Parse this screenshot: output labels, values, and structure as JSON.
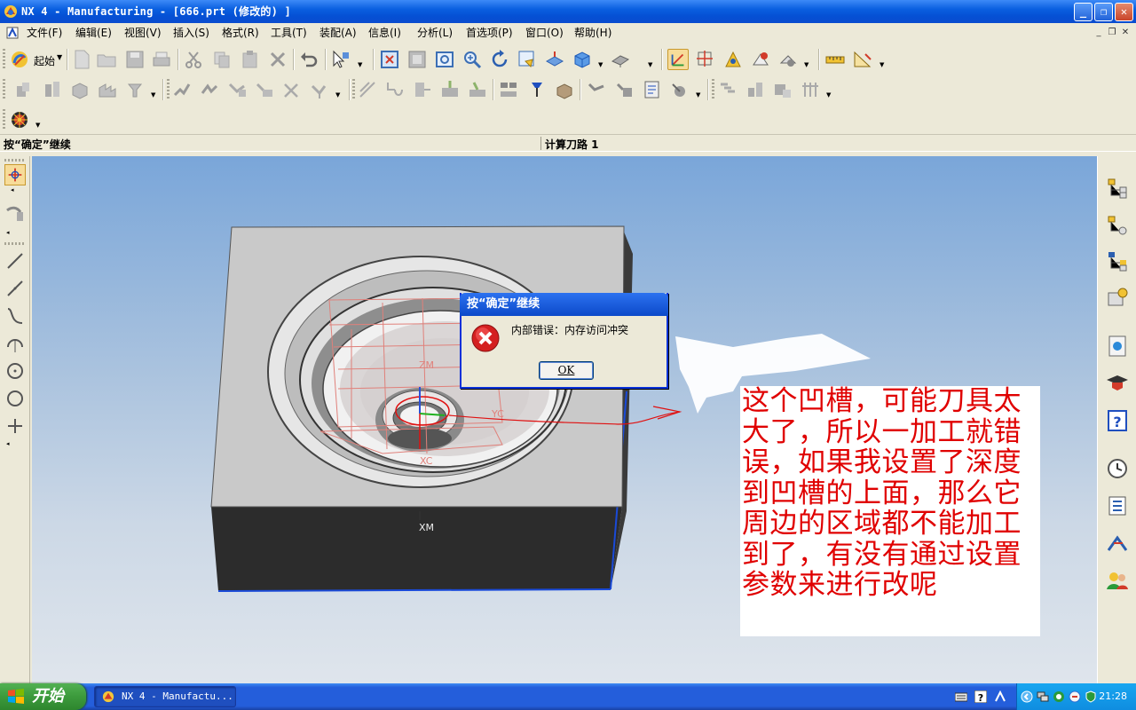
{
  "window": {
    "title": "NX 4 - Manufacturing - [666.prt (修改的) ]",
    "controls": [
      "minimize",
      "restore",
      "close"
    ]
  },
  "menubar": {
    "items": [
      "文件(F)",
      "编辑(E)",
      "视图(V)",
      "插入(S)",
      "格式(R)",
      "工具(T)",
      "装配(A)",
      "信息(I)",
      "分析(L)",
      "首选项(P)",
      "窗口(O)",
      "帮助(H)"
    ]
  },
  "toolbar": {
    "start_label": "起始"
  },
  "status": {
    "cue": "按“确定”继续",
    "status": "计算刀路 1"
  },
  "viewport": {
    "labels": {
      "zm": "ZM",
      "yc": "YC",
      "xc": "XC",
      "xm": "XM"
    }
  },
  "dialog": {
    "title": "按“确定”继续",
    "message": "内部错误：内存访问冲突",
    "ok_label": "OK"
  },
  "annotation": {
    "text": "这个凹槽，可能刀具太大了，所以一加工就错误，如果我设置了深度到凹槽的上面，那么它周边的区域都不能加工到了，有没有通过设置参数来进行改呢"
  },
  "taskbar": {
    "start_label": "开始",
    "task_label": "NX 4 - Manufactu...",
    "clock": "21:28"
  },
  "colors": {
    "titlebar": "#0a5fe0",
    "annotation_text": "#e00000",
    "model_top": "#c8c8c8",
    "model_side": "#2b2b2b"
  }
}
